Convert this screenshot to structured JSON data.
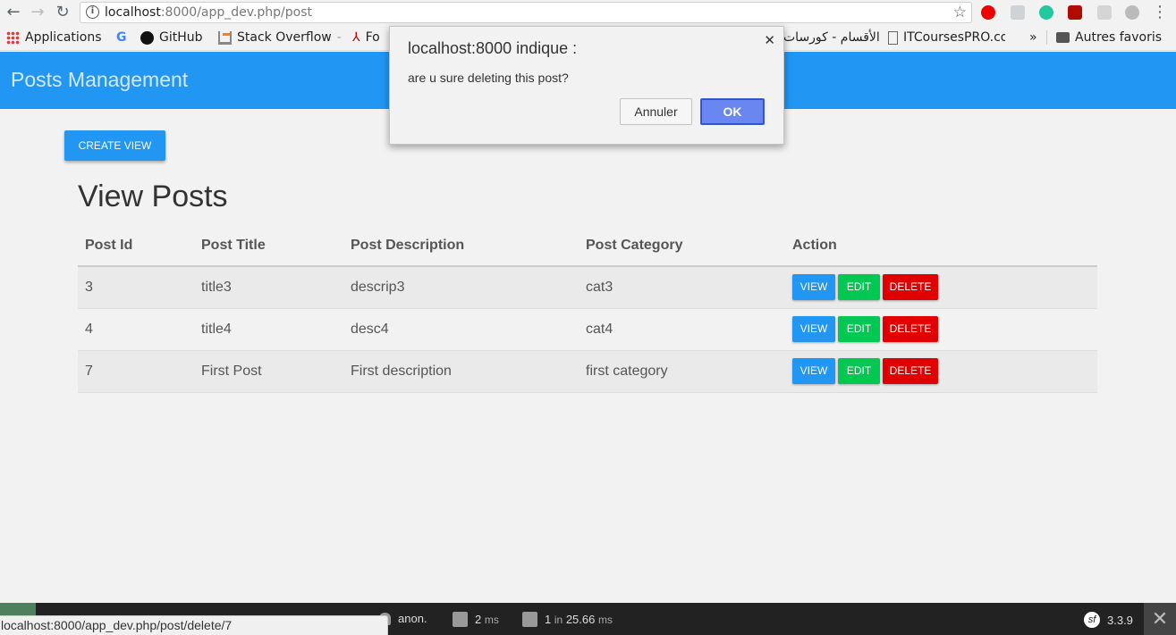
{
  "browser": {
    "url_host": "localhost",
    "url_rest": ":8000/app_dev.php/post",
    "bookmarks": [
      {
        "label": "Applications"
      },
      {
        "label": "GitHub"
      },
      {
        "label": "Stack Overflow"
      },
      {
        "label": "Fo"
      },
      {
        "label": "الأقسام - كورسات"
      },
      {
        "label": "ITCoursesPRO.co"
      },
      {
        "label": "Autres favoris"
      }
    ],
    "overflow": "»",
    "status_url": "localhost:8000/app_dev.php/post/delete/7"
  },
  "app": {
    "title": "Posts Management",
    "create_button": "CREATE VIEW",
    "page_title": "View Posts"
  },
  "table": {
    "headers": [
      "Post Id",
      "Post Title",
      "Post Description",
      "Post Category",
      "Action"
    ],
    "rows": [
      {
        "id": "3",
        "title": "title3",
        "description": "descrip3",
        "category": "cat3"
      },
      {
        "id": "4",
        "title": "title4",
        "description": "desc4",
        "category": "cat4"
      },
      {
        "id": "7",
        "title": "First Post",
        "description": "First description",
        "category": "first category"
      }
    ],
    "actions": {
      "view": "VIEW",
      "edit": "EDIT",
      "delete": "DELETE"
    }
  },
  "dialog": {
    "title": "localhost:8000 indique :",
    "message": "are u sure deleting this post?",
    "cancel": "Annuler",
    "ok": "OK"
  },
  "symfony_toolbar": {
    "user": "anon.",
    "time_value": "2",
    "time_unit": "ms",
    "db_count": "1",
    "db_in": "in",
    "db_time": "25.66",
    "db_unit": "ms",
    "version": "3.3.9"
  },
  "colors": {
    "primary": "#2196f3",
    "edit": "#00c853",
    "delete": "#e00000"
  }
}
